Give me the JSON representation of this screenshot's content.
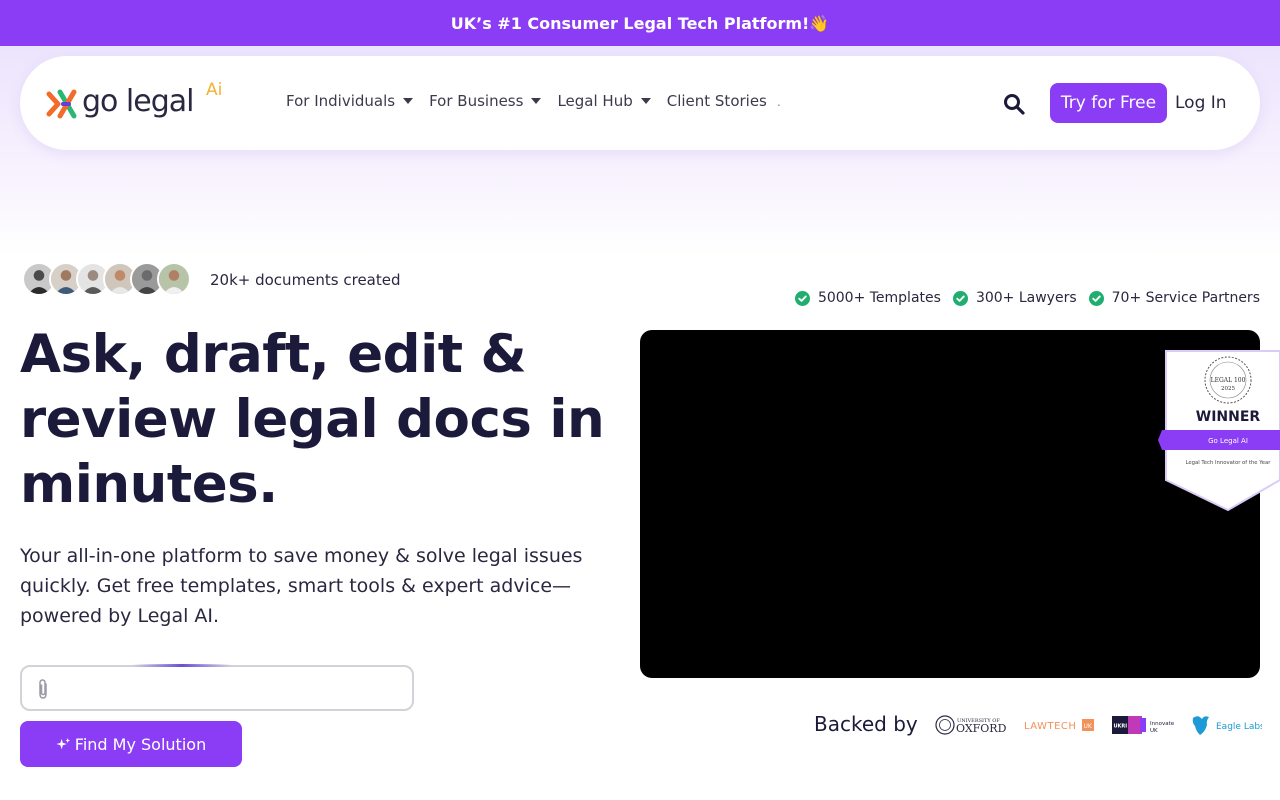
{
  "promo": {
    "text": "UK’s #1 Consumer Legal Tech Platform!👋"
  },
  "header": {
    "logo_text": "go legal",
    "logo_ai": "Ai",
    "nav": [
      {
        "label": "For Individuals"
      },
      {
        "label": "For Business"
      },
      {
        "label": "Legal Hub"
      },
      {
        "label": "Client Stories"
      }
    ],
    "nav_overflow": ".",
    "try_label": "Try for Free",
    "login_label": "Log In"
  },
  "hero": {
    "docs_created": "20k+ documents created",
    "stats": [
      {
        "label": "5000+ Templates"
      },
      {
        "label": "300+ Lawyers"
      },
      {
        "label": "70+ Service Partners"
      }
    ],
    "headline": "Ask, draft, edit & review legal docs in minutes.",
    "subtext": "Your all-in-one platform to save money & solve legal issues quickly. Get free templates, smart tools & expert advice—powered by Legal AI.",
    "prompt_value": "",
    "find_label": "Find My Solution"
  },
  "badge": {
    "award_top": "LEGAL 100",
    "award_year": "2025",
    "winner": "WINNER",
    "ribbon": "Go Legal AI",
    "category": "Legal Tech Innovator of the Year"
  },
  "backed": {
    "label": "Backed by",
    "partners": {
      "oxford_small": "UNIVERSITY OF",
      "oxford": "OXFORD",
      "lawtech": "LAWTECH",
      "lawtech_uk": "UK",
      "ukri": "UKRI",
      "innovate": "Innovate",
      "innovate_uk": "UK",
      "eagle": "Eagle Labs"
    }
  },
  "colors": {
    "brand_purple": "#8b3df5",
    "check_green": "#1fae6f",
    "logo_orange": "#f26b2a",
    "logo_green": "#2bb673",
    "logo_ai_gold": "#f2b233"
  }
}
